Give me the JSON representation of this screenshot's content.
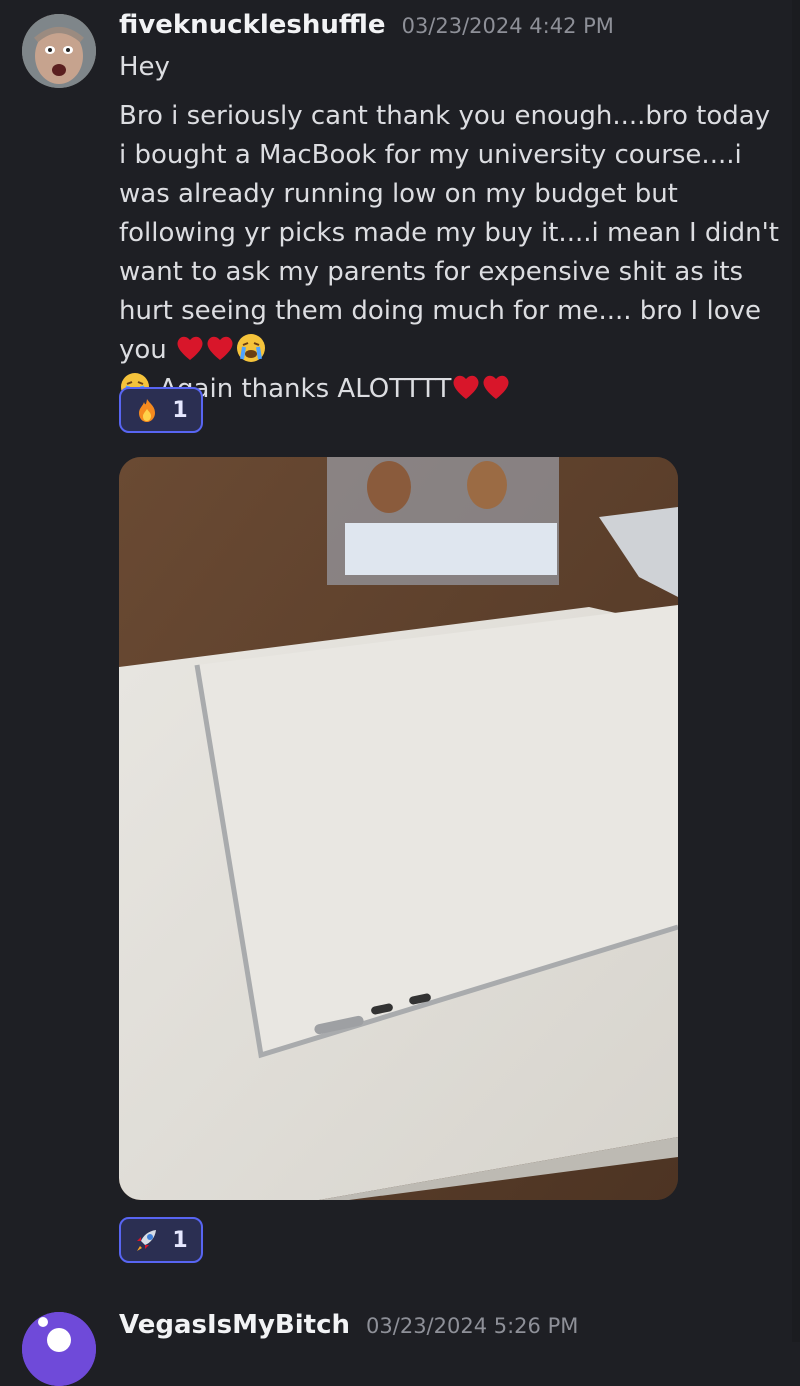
{
  "messages": [
    {
      "username": "fiveknuckleshuffle",
      "timestamp": "03/23/2024 4:42 PM",
      "lines": [
        "Hey",
        "Bro i seriously cant thank you enough....bro today i bought a MacBook for my university course....i was already running low on my budget but following yr picks made my buy it....i mean I didn't want to ask my parents for expensive shit as its hurt seeing them doing much for me.... bro I love you",
        "Again thanks ALOTTTT"
      ],
      "reactions": [
        {
          "icon": "fire-icon",
          "count": "1"
        },
        {
          "icon": "rocket-icon",
          "count": "1"
        }
      ],
      "attachment": {
        "type": "image"
      }
    },
    {
      "username": "VegasIsMyBitch",
      "timestamp": "03/23/2024 5:26 PM"
    }
  ],
  "colors": {
    "background": "#1e1f24",
    "reaction_border": "#5865f2",
    "reaction_bg": "#2b2f52",
    "heart": "#d8162a"
  }
}
